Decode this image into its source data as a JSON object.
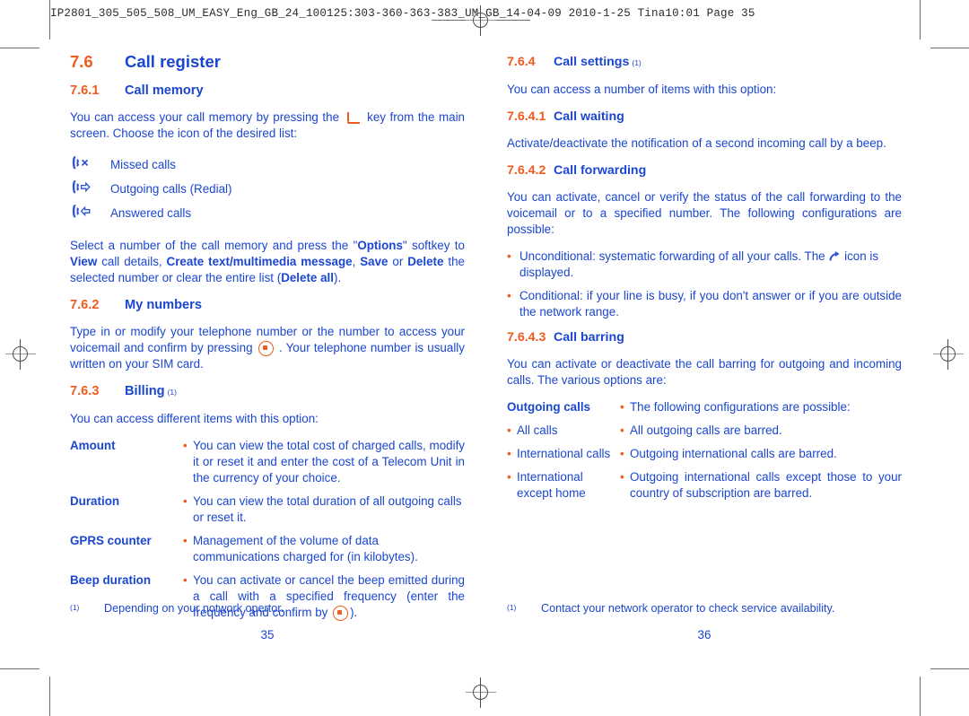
{
  "slug": "IP2801_305_505_508_UM_EASY_Eng_GB_24_100125:303-360-363-383_UM_GB_14-04-09   2010-1-25   Tina10:01   Page 35",
  "colors": {
    "heading_orange": "#ef5a1e",
    "body_blue": "#1b46cf",
    "mark_gray": "#6d6d6d"
  },
  "left": {
    "h_76": {
      "num": "7.6",
      "title": "Call register"
    },
    "h_761": {
      "num": "7.6.1",
      "title": "Call memory"
    },
    "intro_p1": "You can access your call memory by pressing the",
    "intro_p2": "key from the main screen. Choose the icon of the desired list:",
    "call_types": [
      {
        "icon": "missed-call-icon",
        "label": "Missed calls"
      },
      {
        "icon": "outgoing-call-icon",
        "label": "Outgoing calls (Redial)"
      },
      {
        "icon": "answered-call-icon",
        "label": "Answered calls"
      }
    ],
    "options_p": {
      "t1": "Select a number of the call memory and press the \"",
      "b1": "Options",
      "t2": "\" softkey to ",
      "b2": "View",
      "t3": " call details, ",
      "b3": "Create text/multimedia message",
      "t4": ", ",
      "b4": "Save",
      "t5": " or ",
      "b5": "Delete",
      "t6": " the selected number or clear the entire list (",
      "b6": "Delete all",
      "t7": ")."
    },
    "h_762": {
      "num": "7.6.2",
      "title": "My numbers"
    },
    "mynumbers_p1": "Type in or modify your telephone number or the number to access your voicemail and confirm by pressing",
    "mynumbers_p2": ". Your telephone number is usually written on your SIM card.",
    "h_763": {
      "num": "7.6.3",
      "title": "Billing",
      "footnote": "(1)"
    },
    "billing_intro": "You can access different items with this option:",
    "billing_items": [
      {
        "term": "Amount",
        "desc": "You can view the total cost of charged calls, modify it or reset it and enter the cost of a Telecom Unit in the currency of your choice."
      },
      {
        "term": "Duration",
        "desc": "You can view the total duration of all outgoing calls or reset it."
      },
      {
        "term": "GPRS counter",
        "desc": "Management of the volume of data communications charged for (in kilobytes)."
      }
    ],
    "beep": {
      "term": "Beep duration",
      "desc_p1": "You can activate or cancel the beep emitted during a call with a specified frequency (enter the frequency and confirm by",
      "desc_p2": ")."
    },
    "footnote": {
      "mark": "(1)",
      "text": "Depending on your notwork opertor."
    },
    "folio": "35"
  },
  "right": {
    "h_764": {
      "num": "7.6.4",
      "title": "Call settings",
      "footnote": "(1)"
    },
    "settings_intro": "You can access a number of items with this option:",
    "h_7641": {
      "num": "7.6.4.1",
      "title": "Call waiting"
    },
    "waiting_p": "Activate/deactivate the notification of a second incoming call by a beep.",
    "h_7642": {
      "num": "7.6.4.2",
      "title": "Call forwarding"
    },
    "forwarding_p": "You can activate, cancel or verify the status of the call forwarding to the voicemail or to a specified number. The following configurations are possible:",
    "forwarding_bullets": [
      {
        "t1": "Unconditional: systematic forwarding of all your calls. The",
        "icon": "call-forward-icon",
        "t2": "icon is displayed."
      },
      {
        "t1": "Conditional: if your line is busy, if you don't answer or if you are outside the network range.",
        "icon": "",
        "t2": ""
      }
    ],
    "h_7643": {
      "num": "7.6.4.3",
      "title": "Call barring"
    },
    "barring_p": "You can activate or deactivate the call barring for outgoing and incoming calls. The various options are:",
    "barring_rows": [
      {
        "left_bullet": false,
        "left_bold": true,
        "left": "Outgoing calls",
        "right": "The following configurations are possible:"
      },
      {
        "left_bullet": true,
        "left_bold": false,
        "left": "All calls",
        "right": "All outgoing calls are barred."
      },
      {
        "left_bullet": true,
        "left_bold": false,
        "left": "International calls",
        "right": "Outgoing international calls are barred."
      },
      {
        "left_bullet": true,
        "left_bold": false,
        "left": "International except home",
        "right": "Outgoing international calls except those to your country of subscription are barred."
      }
    ],
    "footnote": {
      "mark": "(1)",
      "text": "Contact your network operator to check service availability."
    },
    "folio": "36"
  }
}
